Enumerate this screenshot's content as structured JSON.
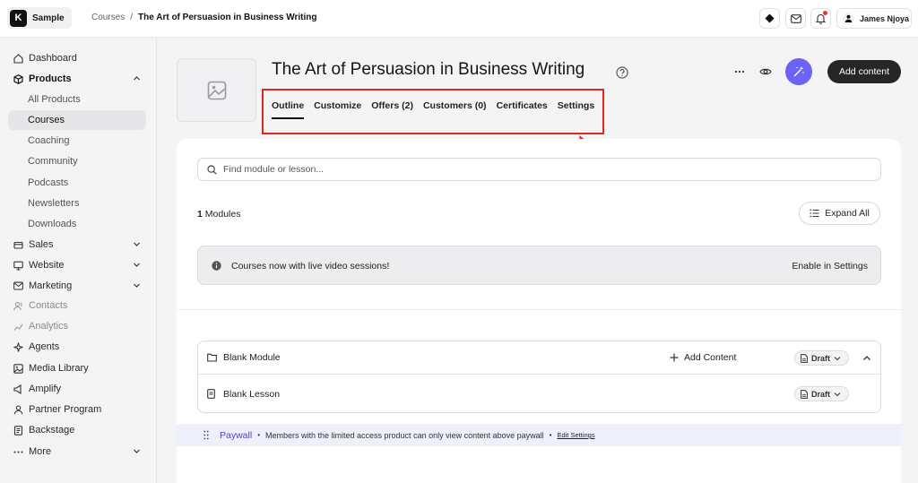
{
  "brand": {
    "name": "Sample",
    "logo_letter": "K"
  },
  "breadcrumb": {
    "parent": "Courses",
    "separator": "/",
    "current": "The Art of Persuasion in Business Writing"
  },
  "user": {
    "name": "James Njoya"
  },
  "colors": {
    "accent": "#6c63f6",
    "highlight": "#e3261b",
    "dark_button": "#262626",
    "notification": "#e53935"
  },
  "sidebar": {
    "items": [
      {
        "label": "Dashboard",
        "icon": "home-icon"
      },
      {
        "label": "Products",
        "icon": "box-icon"
      },
      {
        "label": "All Products"
      },
      {
        "label": "Courses"
      },
      {
        "label": "Coaching"
      },
      {
        "label": "Community"
      },
      {
        "label": "Podcasts"
      },
      {
        "label": "Newsletters"
      },
      {
        "label": "Downloads"
      },
      {
        "label": "Sales",
        "icon": "cart-icon"
      },
      {
        "label": "Website",
        "icon": "monitor-icon"
      },
      {
        "label": "Marketing",
        "icon": "mail-icon"
      },
      {
        "label": "Contacts",
        "icon": "contacts-icon"
      },
      {
        "label": "Analytics",
        "icon": "analytics-icon"
      },
      {
        "label": "Agents",
        "icon": "sparkle-icon"
      },
      {
        "label": "Media Library",
        "icon": "image-icon"
      },
      {
        "label": "Amplify",
        "icon": "amplify-icon"
      },
      {
        "label": "Partner Program",
        "icon": "partner-icon"
      },
      {
        "label": "Backstage",
        "icon": "backstage-icon"
      },
      {
        "label": "More",
        "icon": "dots-icon"
      }
    ]
  },
  "course": {
    "title": "The Art of Persuasion in Business Writing",
    "add_content_label": "Add content"
  },
  "tabs": [
    {
      "label": "Outline"
    },
    {
      "label": "Customize"
    },
    {
      "label": "Offers (2)"
    },
    {
      "label": "Customers (0)"
    },
    {
      "label": "Certificates"
    },
    {
      "label": "Settings"
    }
  ],
  "outline": {
    "search_placeholder": "Find module or lesson...",
    "modules_count": "1",
    "modules_label": "Modules",
    "expand_label": "Expand All",
    "banner_text": "Courses now with live video sessions!",
    "banner_link": "Enable in Settings",
    "module": {
      "name": "Blank Module",
      "add_content": "Add Content",
      "status": "Draft"
    },
    "lesson": {
      "name": "Blank Lesson",
      "status": "Draft"
    },
    "paywall": {
      "label": "Paywall",
      "bullet": "•",
      "text": "Members with the limited access product can only view content above paywall",
      "link": "Edit Settings"
    }
  }
}
